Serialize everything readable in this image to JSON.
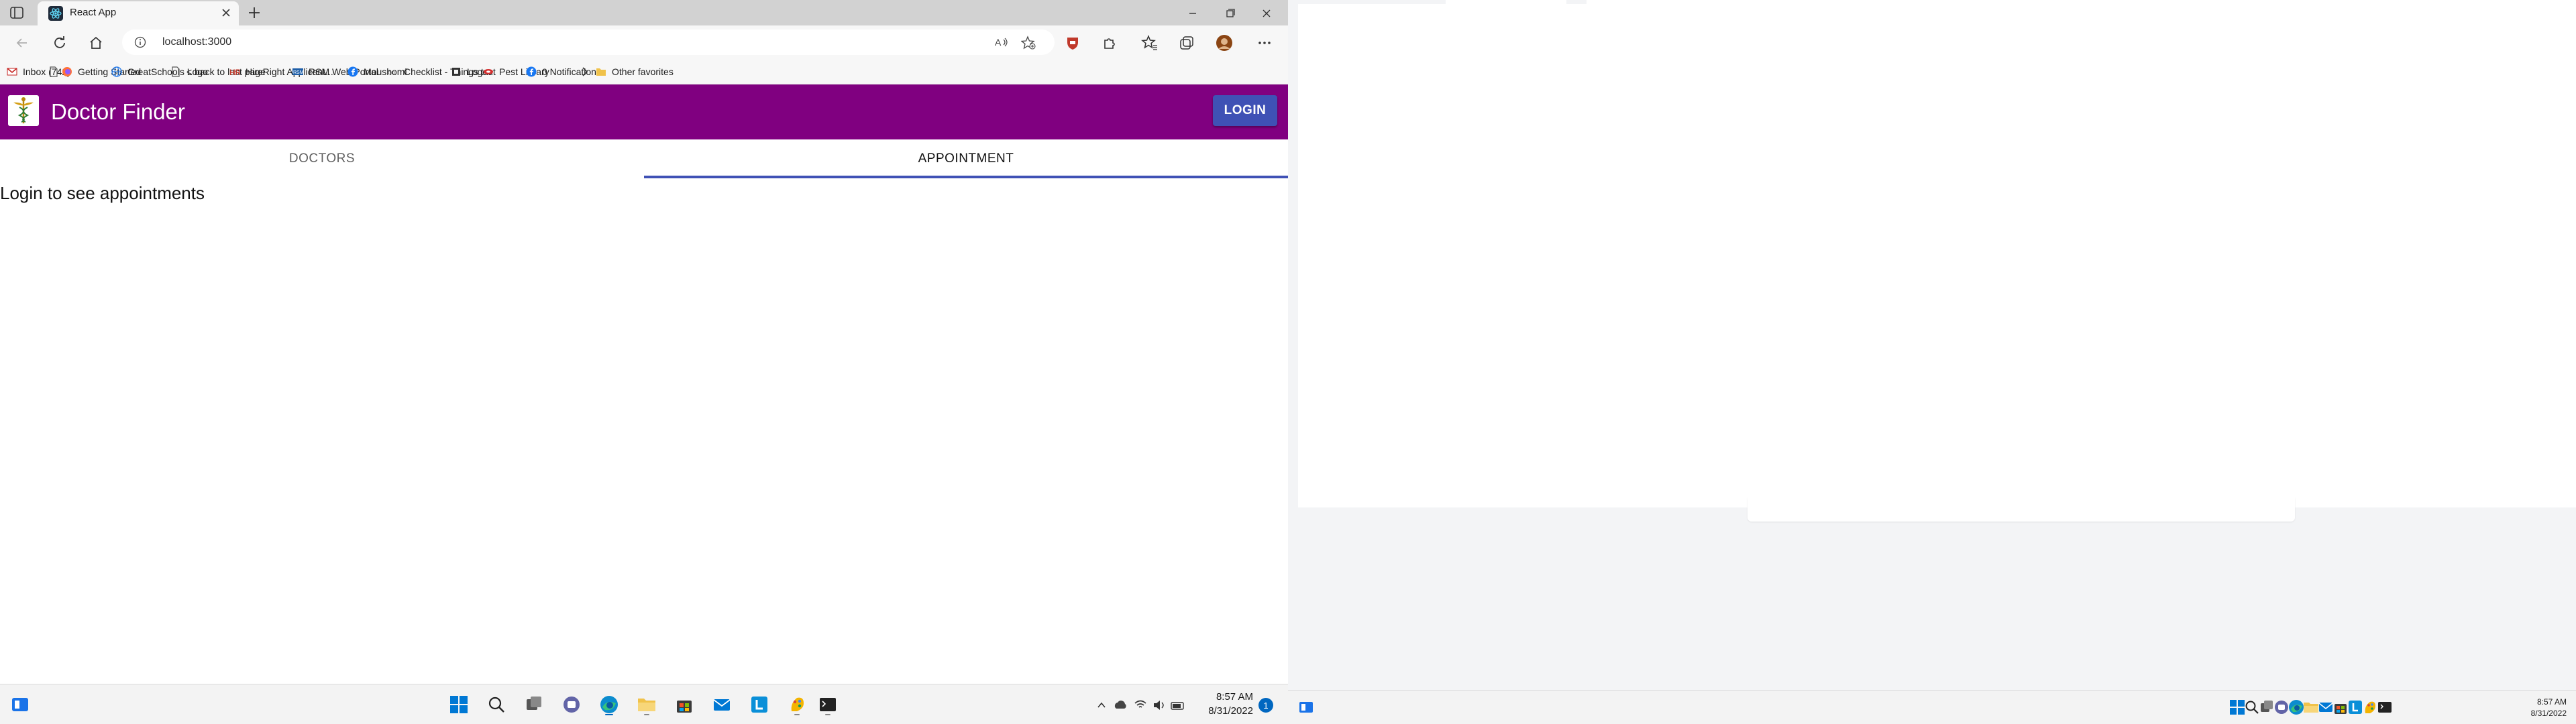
{
  "browser": {
    "tab_title": "React App",
    "address": "localhost:3000"
  },
  "bookmarks": [
    {
      "label": "Inbox (742)",
      "icon": "gmail-icon"
    },
    {
      "label": "Getting Started",
      "icon": "firefox-icon"
    },
    {
      "label": "GreatSchools Logo",
      "icon": "globe-icon"
    },
    {
      "label": "< back to last page",
      "icon": "page-icon"
    },
    {
      "label": "HireRight Applicant...",
      "icon": "hireright-icon"
    },
    {
      "label": "RSM Web Portal",
      "icon": "rsm-icon"
    },
    {
      "label": "Moushomi",
      "icon": "facebook-icon"
    },
    {
      "label": "Checklist - Things t...",
      "icon": "checklist-icon"
    },
    {
      "label": "Logout",
      "icon": "logout-icon"
    },
    {
      "label": "Pest Library",
      "icon": "pest-icon"
    },
    {
      "label": "0 Notifications",
      "icon": "facebook-icon"
    }
  ],
  "other_favorites": "Other favorites",
  "app": {
    "title": "Doctor Finder",
    "login_label": "LOGIN",
    "tabs": [
      "DOCTORS",
      "APPOINTMENT"
    ],
    "selected_tab": "APPOINTMENT",
    "message": "Login to see appointments"
  },
  "taskbar_left": {
    "time": "8:57 AM",
    "date": "8/31/2022",
    "notification_count": "1"
  },
  "taskbar_right": {
    "time": "8:57 AM",
    "date": "8/31/2022"
  },
  "colors": {
    "app_bar": "#800080",
    "primary": "#3f51b5"
  }
}
